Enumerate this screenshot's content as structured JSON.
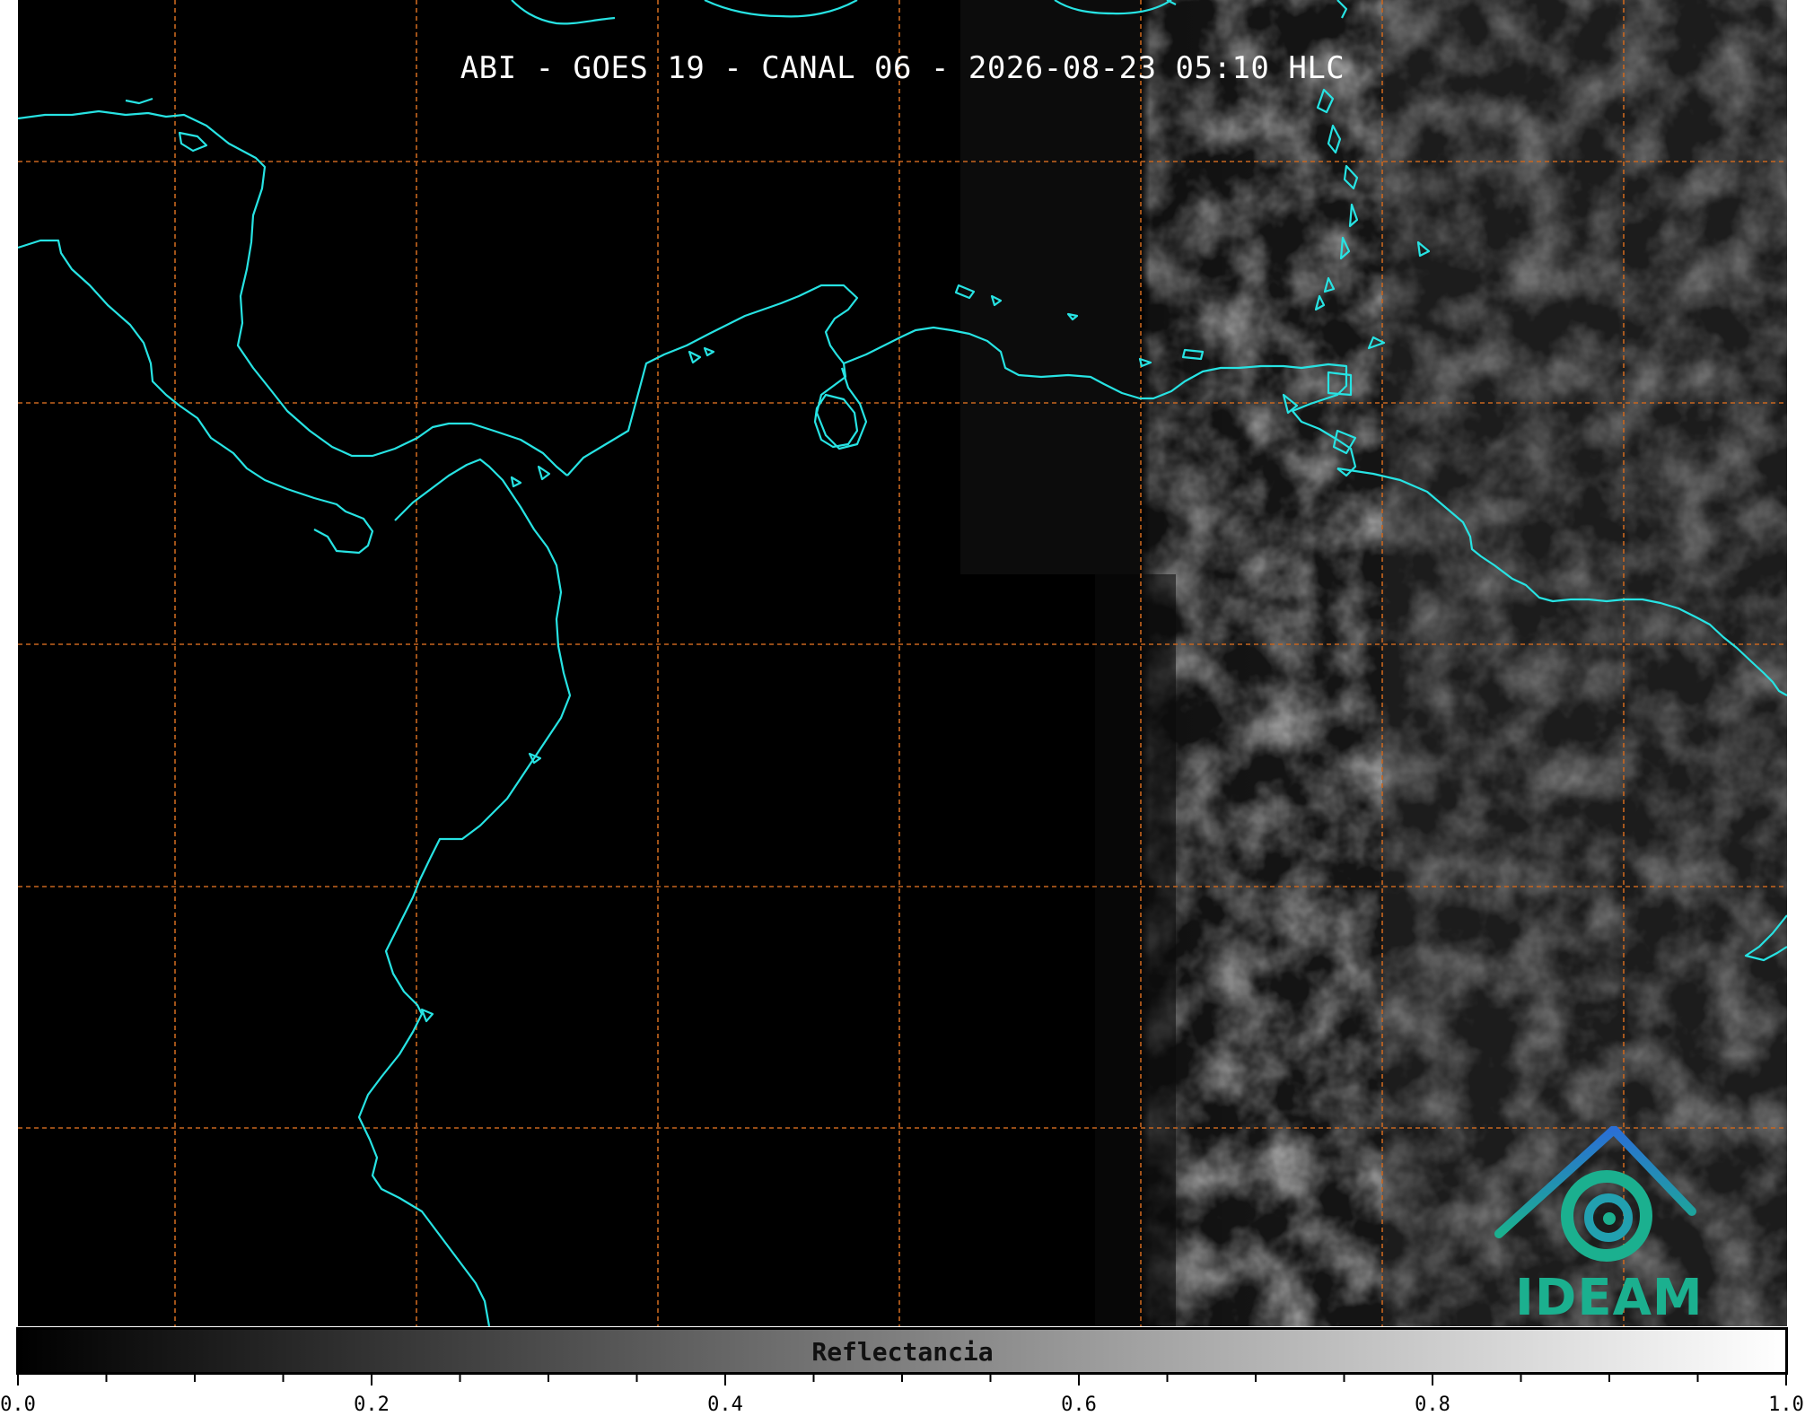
{
  "title": "ABI - GOES 19 - CANAL 06 - 2026-08-23 05:10 HLC",
  "logo": {
    "text": "IDEAM",
    "icon": "ideam-logo-icon"
  },
  "colorbar": {
    "label": "Reflectancia",
    "min": 0.0,
    "max": 1.0,
    "ticks": [
      "0.0",
      "0.2",
      "0.4",
      "0.6",
      "0.8",
      "1.0"
    ],
    "colors": [
      "#000000",
      "#ffffff"
    ]
  },
  "colors": {
    "coastline": "#27e3e3",
    "graticule": "#c8661f",
    "background": "#000000"
  }
}
